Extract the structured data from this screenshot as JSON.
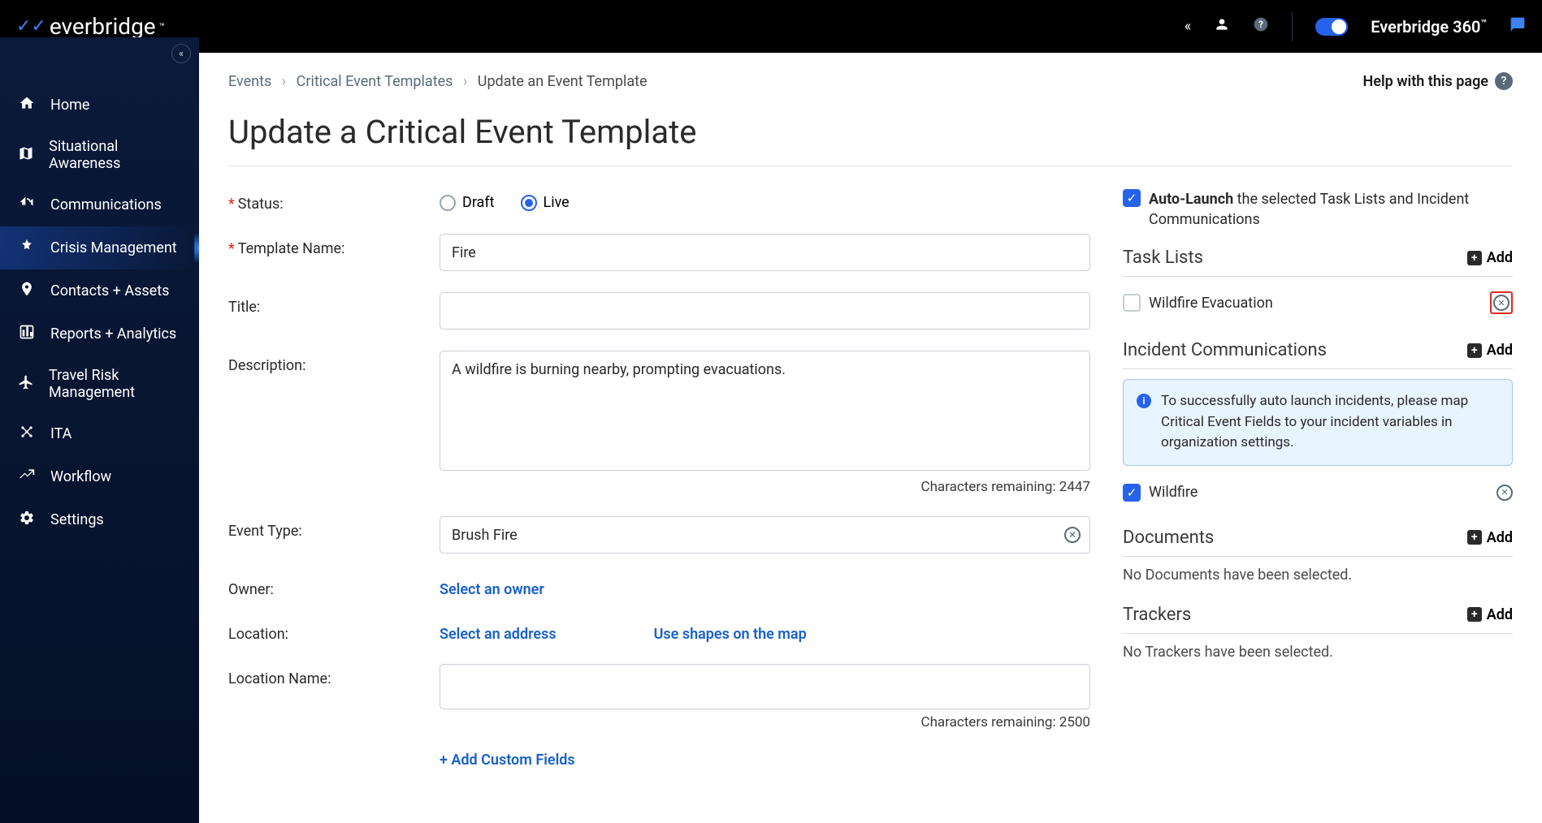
{
  "topbar": {
    "logo_text": "everbridge",
    "brand_label": "Everbridge 360",
    "brand_tm": "™"
  },
  "sidebar": {
    "items": [
      {
        "label": "Home"
      },
      {
        "label": "Situational Awareness"
      },
      {
        "label": "Communications"
      },
      {
        "label": "Crisis Management"
      },
      {
        "label": "Contacts + Assets"
      },
      {
        "label": "Reports + Analytics"
      },
      {
        "label": "Travel Risk Management"
      },
      {
        "label": "ITA"
      },
      {
        "label": "Workflow"
      },
      {
        "label": "Settings"
      }
    ]
  },
  "breadcrumb": {
    "level1": "Events",
    "level2": "Critical Event Templates",
    "current": "Update an Event Template",
    "help": "Help with this page"
  },
  "page": {
    "title": "Update a Critical Event Template"
  },
  "form": {
    "status_label": "Status:",
    "status_draft": "Draft",
    "status_live": "Live",
    "template_name_label": "Template Name:",
    "template_name_value": "Fire",
    "title_label": "Title:",
    "title_value": "",
    "description_label": "Description:",
    "description_value": "A wildfire is burning nearby, prompting evacuations.",
    "desc_chars": "Characters remaining: 2447",
    "event_type_label": "Event Type:",
    "event_type_value": "Brush Fire",
    "owner_label": "Owner:",
    "owner_action": "Select an owner",
    "location_label": "Location:",
    "location_select": "Select an address",
    "location_shapes": "Use shapes on the map",
    "location_name_label": "Location Name:",
    "location_name_value": "",
    "locname_chars": "Characters remaining: 2500",
    "add_custom_fields": "+ Add Custom Fields"
  },
  "side": {
    "auto_launch_bold": "Auto-Launch",
    "auto_launch_rest": " the selected Task Lists and Incident Communications",
    "task_lists_title": "Task Lists",
    "add_label": "Add",
    "task_list_item": "Wildfire Evacuation",
    "incident_comm_title": "Incident Communications",
    "info_text": "To successfully auto launch incidents, please map Critical Event Fields to your incident variables in organization settings.",
    "incident_item": "Wildfire",
    "documents_title": "Documents",
    "documents_empty": "No Documents have been selected.",
    "trackers_title": "Trackers",
    "trackers_empty": "No Trackers have been selected."
  }
}
